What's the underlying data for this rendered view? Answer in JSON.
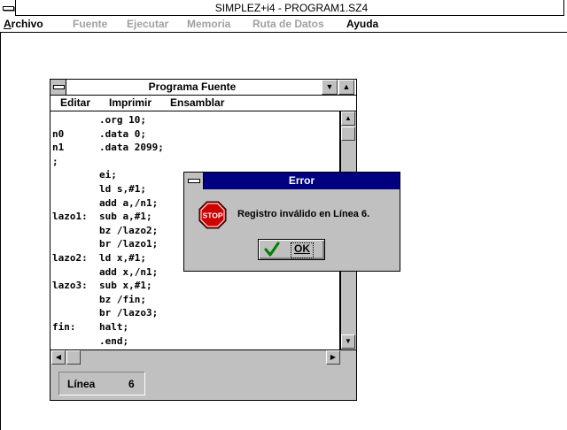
{
  "app": {
    "title": "SIMPLEZ+i4 - PROGRAM1.SZ4"
  },
  "menubar": [
    {
      "label": "Archivo",
      "enabled": true
    },
    {
      "label": "Fuente",
      "enabled": false
    },
    {
      "label": "Ejecutar",
      "enabled": false
    },
    {
      "label": "Memoria",
      "enabled": false
    },
    {
      "label": "Ruta de Datos",
      "enabled": false
    },
    {
      "label": "Ayuda",
      "enabled": true
    }
  ],
  "source_window": {
    "title": "Programa Fuente",
    "menu": [
      {
        "label": "Editar"
      },
      {
        "label": "Imprimir"
      },
      {
        "label": "Ensamblar"
      }
    ],
    "code_lines": [
      "        .org 10;",
      "n0      .data 0;",
      "n1      .data 2099;",
      ";",
      "        ei;",
      "        ld s,#1;",
      "        add a,/n1;",
      "lazo1:  sub a,#1;",
      "        bz /lazo2;",
      "        br /lazo1;",
      "lazo2:  ld x,#1;",
      "        add x,/n1;",
      "lazo3:  sub x,#1;",
      "        bz /fin;",
      "        br /lazo3;",
      "fin:    halt;",
      "        .end;"
    ],
    "status": {
      "label": "Línea",
      "value": "6"
    }
  },
  "dialog": {
    "title": "Error",
    "icon": "stop-sign-icon",
    "icon_text": "STOP",
    "message": "Registro inválido en Línea  6.",
    "ok_label": "OK"
  },
  "colors": {
    "dialog_title_bg": "#000080",
    "stop_red": "#cc0000",
    "check_green": "#008000",
    "face": "#c0c0c0"
  }
}
